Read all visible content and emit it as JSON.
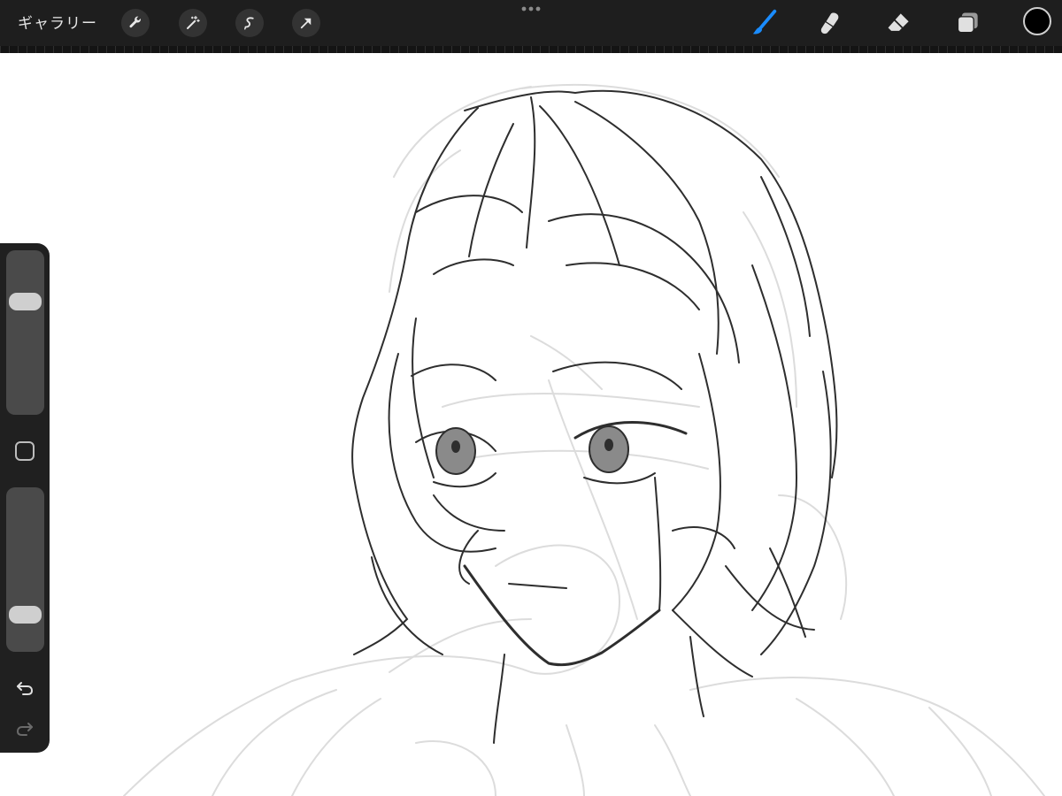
{
  "toolbar": {
    "gallery_label": "ギャラリー",
    "left_tools": [
      "wrench-icon",
      "magic-wand-icon",
      "selection-icon",
      "transform-arrow-icon"
    ],
    "right_tools": [
      "brush-icon",
      "smudge-icon",
      "eraser-icon",
      "layers-icon"
    ],
    "active_tool": "brush",
    "active_color": "#000000",
    "accent_color": "#1a8cff"
  },
  "sidebar": {
    "brush_size_level": 0.72,
    "opacity_level": 0.18,
    "buttons": [
      "modifier-square-icon",
      "undo-icon",
      "redo-icon"
    ]
  },
  "canvas": {
    "background": "#ffffff",
    "content": "sketch-drawing"
  }
}
